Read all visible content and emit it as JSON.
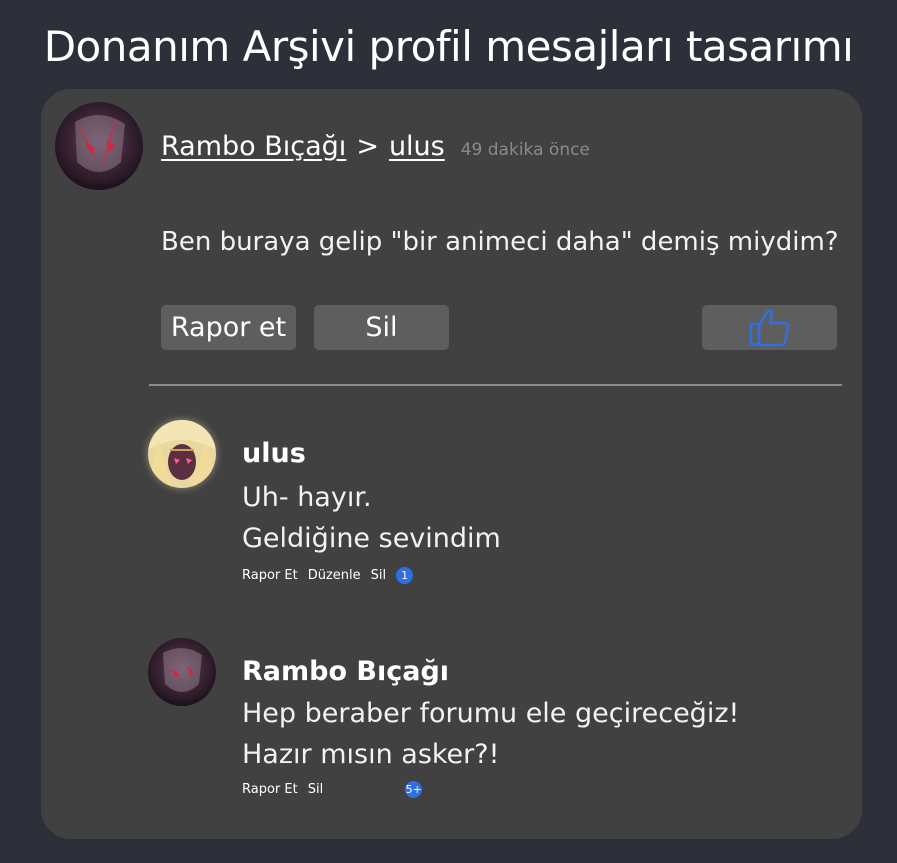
{
  "page_title": "Donanım Arşivi profil mesajları tasarımı",
  "post": {
    "author": "Rambo Bıçağı",
    "separator": ">",
    "recipient": "ulus",
    "time": "49 dakika önce",
    "text": "Ben buraya gelip \"bir animeci daha\" demiş miydim?",
    "report_label": "Rapor et",
    "delete_label": "Sil",
    "like_icon": "thumbs-up-icon",
    "like_color": "#2f6fe0"
  },
  "replies": [
    {
      "author": "ulus",
      "lines": [
        "Uh- hayır.",
        "Geldiğine sevindim"
      ],
      "actions": [
        "Rapor Et",
        "Düzenle",
        "Sil"
      ],
      "badge": "1"
    },
    {
      "author": "Rambo Bıçağı",
      "lines": [
        "Hep beraber forumu ele geçireceğiz!",
        "Hazır mısın asker?!"
      ],
      "actions": [
        "Rapor Et",
        "Sil"
      ],
      "badge": "5+"
    }
  ]
}
